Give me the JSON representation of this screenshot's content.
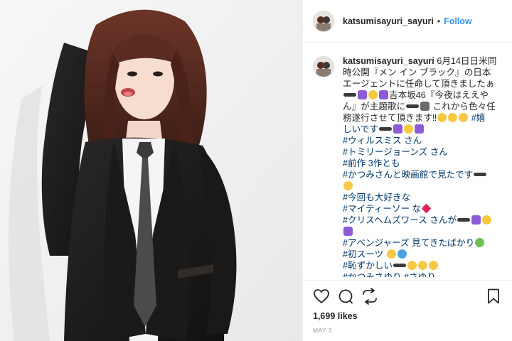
{
  "post": {
    "username": "katsumisayuri_sayuri",
    "separator": "•",
    "follow_label": "Follow",
    "caption": {
      "username": "katsumisayuri_sayuri",
      "lines": [
        "6月14日日米同",
        "時公開『メン イン ブラック』の日本",
        "エージェントに任命して頂きましたぁ",
        "吉本坂46『今夜はええや",
        "ん』が主題歌に",
        "これから色々任",
        "務遂行させて頂きます‼",
        "しいです",
        "#ウィルスミス さん",
        "#トミリージョーンズ さん",
        "#前作 3作とも",
        "#かつみさんと映画館で見たです",
        "#今回も大好きな",
        "#マイティーソー な",
        "#クリスヘムズワース さんが",
        "#アベンジャーズ 見てきたばかり",
        "#初スーツ",
        "#恥ずかしい",
        "#かつみさゆり #さゆり"
      ],
      "hashtag_1": "#嬉",
      "text_1": "#嬉"
    },
    "likes_label": "1,699 likes",
    "date_label": "MAY 3"
  },
  "icons": {
    "like": "heart-icon",
    "comment": "comment-icon",
    "share": "share-icon",
    "save": "bookmark-icon"
  },
  "colors": {
    "link": "#3897f0",
    "hashtag": "#003569",
    "text": "#262626",
    "muted": "#999999",
    "border": "#efefef"
  }
}
